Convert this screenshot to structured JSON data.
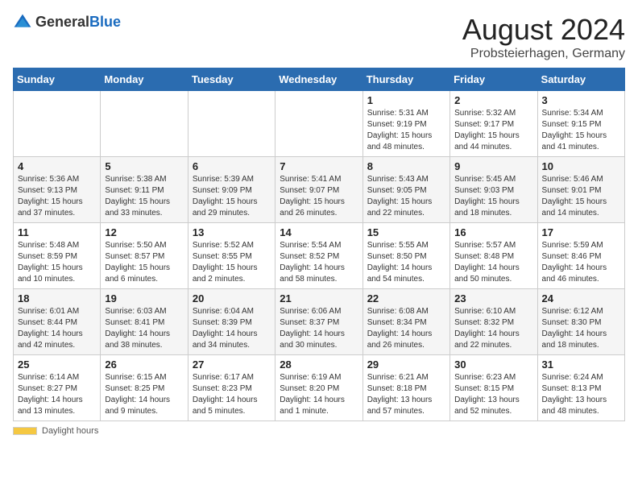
{
  "logo": {
    "general": "General",
    "blue": "Blue"
  },
  "title": "August 2024",
  "subtitle": "Probsteierhagen, Germany",
  "days_of_week": [
    "Sunday",
    "Monday",
    "Tuesday",
    "Wednesday",
    "Thursday",
    "Friday",
    "Saturday"
  ],
  "footer": {
    "label": "Daylight hours"
  },
  "weeks": [
    [
      {
        "day": "",
        "info": ""
      },
      {
        "day": "",
        "info": ""
      },
      {
        "day": "",
        "info": ""
      },
      {
        "day": "",
        "info": ""
      },
      {
        "day": "1",
        "info": "Sunrise: 5:31 AM\nSunset: 9:19 PM\nDaylight: 15 hours\nand 48 minutes."
      },
      {
        "day": "2",
        "info": "Sunrise: 5:32 AM\nSunset: 9:17 PM\nDaylight: 15 hours\nand 44 minutes."
      },
      {
        "day": "3",
        "info": "Sunrise: 5:34 AM\nSunset: 9:15 PM\nDaylight: 15 hours\nand 41 minutes."
      }
    ],
    [
      {
        "day": "4",
        "info": "Sunrise: 5:36 AM\nSunset: 9:13 PM\nDaylight: 15 hours\nand 37 minutes."
      },
      {
        "day": "5",
        "info": "Sunrise: 5:38 AM\nSunset: 9:11 PM\nDaylight: 15 hours\nand 33 minutes."
      },
      {
        "day": "6",
        "info": "Sunrise: 5:39 AM\nSunset: 9:09 PM\nDaylight: 15 hours\nand 29 minutes."
      },
      {
        "day": "7",
        "info": "Sunrise: 5:41 AM\nSunset: 9:07 PM\nDaylight: 15 hours\nand 26 minutes."
      },
      {
        "day": "8",
        "info": "Sunrise: 5:43 AM\nSunset: 9:05 PM\nDaylight: 15 hours\nand 22 minutes."
      },
      {
        "day": "9",
        "info": "Sunrise: 5:45 AM\nSunset: 9:03 PM\nDaylight: 15 hours\nand 18 minutes."
      },
      {
        "day": "10",
        "info": "Sunrise: 5:46 AM\nSunset: 9:01 PM\nDaylight: 15 hours\nand 14 minutes."
      }
    ],
    [
      {
        "day": "11",
        "info": "Sunrise: 5:48 AM\nSunset: 8:59 PM\nDaylight: 15 hours\nand 10 minutes."
      },
      {
        "day": "12",
        "info": "Sunrise: 5:50 AM\nSunset: 8:57 PM\nDaylight: 15 hours\nand 6 minutes."
      },
      {
        "day": "13",
        "info": "Sunrise: 5:52 AM\nSunset: 8:55 PM\nDaylight: 15 hours\nand 2 minutes."
      },
      {
        "day": "14",
        "info": "Sunrise: 5:54 AM\nSunset: 8:52 PM\nDaylight: 14 hours\nand 58 minutes."
      },
      {
        "day": "15",
        "info": "Sunrise: 5:55 AM\nSunset: 8:50 PM\nDaylight: 14 hours\nand 54 minutes."
      },
      {
        "day": "16",
        "info": "Sunrise: 5:57 AM\nSunset: 8:48 PM\nDaylight: 14 hours\nand 50 minutes."
      },
      {
        "day": "17",
        "info": "Sunrise: 5:59 AM\nSunset: 8:46 PM\nDaylight: 14 hours\nand 46 minutes."
      }
    ],
    [
      {
        "day": "18",
        "info": "Sunrise: 6:01 AM\nSunset: 8:44 PM\nDaylight: 14 hours\nand 42 minutes."
      },
      {
        "day": "19",
        "info": "Sunrise: 6:03 AM\nSunset: 8:41 PM\nDaylight: 14 hours\nand 38 minutes."
      },
      {
        "day": "20",
        "info": "Sunrise: 6:04 AM\nSunset: 8:39 PM\nDaylight: 14 hours\nand 34 minutes."
      },
      {
        "day": "21",
        "info": "Sunrise: 6:06 AM\nSunset: 8:37 PM\nDaylight: 14 hours\nand 30 minutes."
      },
      {
        "day": "22",
        "info": "Sunrise: 6:08 AM\nSunset: 8:34 PM\nDaylight: 14 hours\nand 26 minutes."
      },
      {
        "day": "23",
        "info": "Sunrise: 6:10 AM\nSunset: 8:32 PM\nDaylight: 14 hours\nand 22 minutes."
      },
      {
        "day": "24",
        "info": "Sunrise: 6:12 AM\nSunset: 8:30 PM\nDaylight: 14 hours\nand 18 minutes."
      }
    ],
    [
      {
        "day": "25",
        "info": "Sunrise: 6:14 AM\nSunset: 8:27 PM\nDaylight: 14 hours\nand 13 minutes."
      },
      {
        "day": "26",
        "info": "Sunrise: 6:15 AM\nSunset: 8:25 PM\nDaylight: 14 hours\nand 9 minutes."
      },
      {
        "day": "27",
        "info": "Sunrise: 6:17 AM\nSunset: 8:23 PM\nDaylight: 14 hours\nand 5 minutes."
      },
      {
        "day": "28",
        "info": "Sunrise: 6:19 AM\nSunset: 8:20 PM\nDaylight: 14 hours\nand 1 minute."
      },
      {
        "day": "29",
        "info": "Sunrise: 6:21 AM\nSunset: 8:18 PM\nDaylight: 13 hours\nand 57 minutes."
      },
      {
        "day": "30",
        "info": "Sunrise: 6:23 AM\nSunset: 8:15 PM\nDaylight: 13 hours\nand 52 minutes."
      },
      {
        "day": "31",
        "info": "Sunrise: 6:24 AM\nSunset: 8:13 PM\nDaylight: 13 hours\nand 48 minutes."
      }
    ]
  ]
}
